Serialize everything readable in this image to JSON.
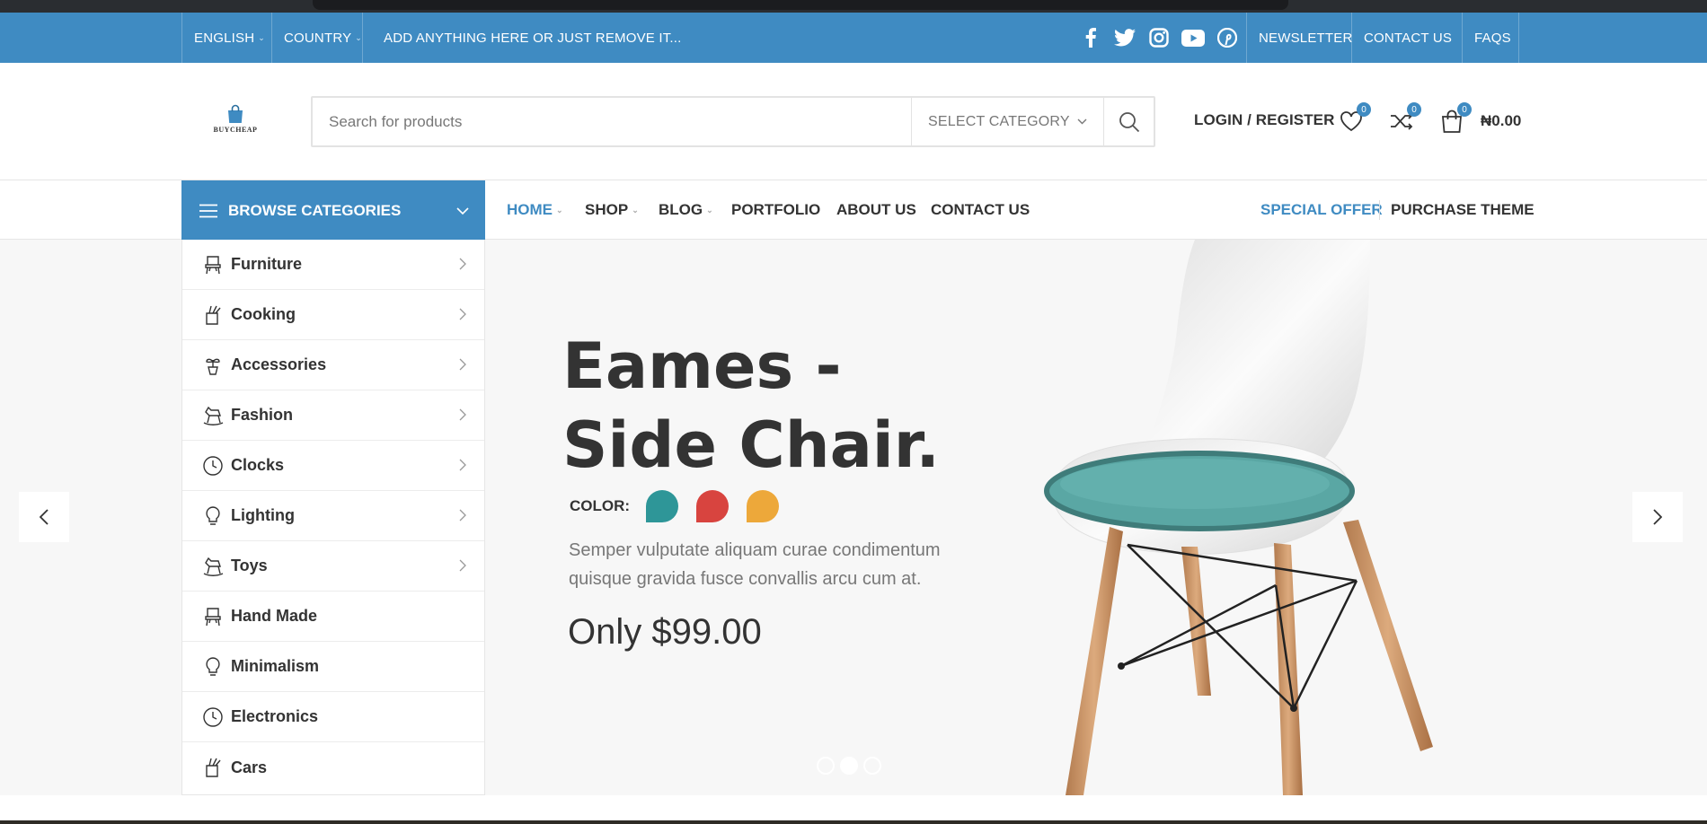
{
  "topbar": {
    "language": "ENGLISH",
    "country": "COUNTRY",
    "promo": "ADD ANYTHING HERE OR JUST REMOVE IT...",
    "social_icons": [
      "facebook-icon",
      "twitter-icon",
      "instagram-icon",
      "youtube-icon",
      "pinterest-icon"
    ],
    "links": [
      "NEWSLETTER",
      "CONTACT US",
      "FAQS"
    ]
  },
  "header": {
    "logo_text": "BUYCHEAP",
    "search_placeholder": "Search for products",
    "category_select": "SELECT CATEGORY",
    "login": "LOGIN / REGISTER",
    "wishlist_count": "0",
    "compare_count": "0",
    "cart_count": "0",
    "cart_total": "₦0.00"
  },
  "nav": {
    "browse_label": "BROWSE CATEGORIES",
    "items": [
      "HOME",
      "SHOP",
      "BLOG",
      "PORTFOLIO",
      "ABOUT US",
      "CONTACT US"
    ],
    "special_offer": "SPECIAL OFFER",
    "purchase_theme": "PURCHASE THEME"
  },
  "categories": [
    {
      "label": "Furniture",
      "icon": "chair-icon",
      "has_submenu": true
    },
    {
      "label": "Cooking",
      "icon": "cooking-icon",
      "has_submenu": true
    },
    {
      "label": "Accessories",
      "icon": "plant-icon",
      "has_submenu": true
    },
    {
      "label": "Fashion",
      "icon": "rocking-horse-icon",
      "has_submenu": true
    },
    {
      "label": "Clocks",
      "icon": "clock-icon",
      "has_submenu": true
    },
    {
      "label": "Lighting",
      "icon": "bulb-icon",
      "has_submenu": true
    },
    {
      "label": "Toys",
      "icon": "rocking-horse-icon",
      "has_submenu": true
    },
    {
      "label": "Hand Made",
      "icon": "chair-icon",
      "has_submenu": false
    },
    {
      "label": "Minimalism",
      "icon": "bulb-icon",
      "has_submenu": false
    },
    {
      "label": "Electronics",
      "icon": "clock-icon",
      "has_submenu": false
    },
    {
      "label": "Cars",
      "icon": "cooking-icon",
      "has_submenu": false
    }
  ],
  "hero": {
    "title_line1": "Eames -",
    "title_line2": "Side Chair.",
    "color_label": "COLOR:",
    "swatches": [
      "#2e9698",
      "#d8443f",
      "#eda83a"
    ],
    "description": "Semper vulputate aliquam curae condimentum quisque gravida fusce convallis arcu cum at.",
    "price": "Only $99.00",
    "active_slide": 2,
    "slide_count": 3
  },
  "colors": {
    "accent": "#3f8bc2",
    "text": "#333333"
  }
}
